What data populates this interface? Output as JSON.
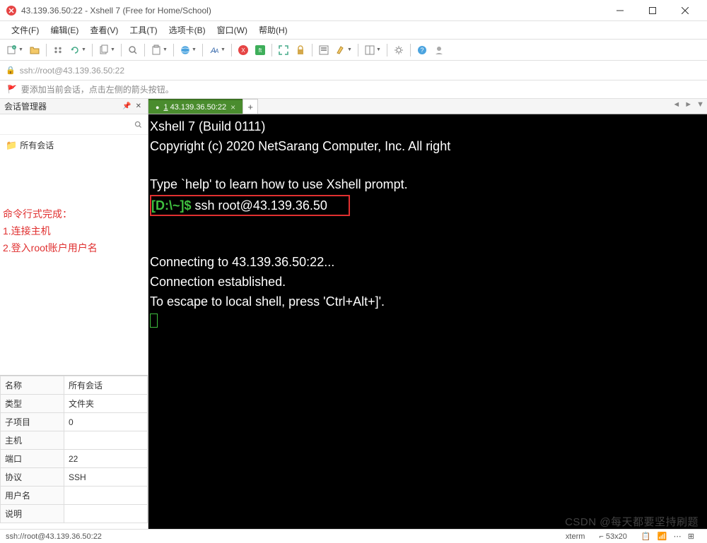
{
  "window": {
    "title": "43.139.36.50:22 - Xshell 7 (Free for Home/School)"
  },
  "menu": {
    "file": "文件(F)",
    "edit": "编辑(E)",
    "view": "查看(V)",
    "tools": "工具(T)",
    "tab": "选项卡(B)",
    "window": "窗口(W)",
    "help": "帮助(H)"
  },
  "addressbar": {
    "url": "ssh://root@43.139.36.50:22"
  },
  "infobar": {
    "text": "要添加当前会话，点击左侧的箭头按钮。"
  },
  "sidebar": {
    "title": "会话管理器",
    "tree_root": "所有会话",
    "annotations": {
      "line1": "命令行式完成：",
      "line2": "1.连接主机",
      "line3": "2.登入root账户用户名"
    },
    "props": [
      {
        "k": "名称",
        "v": "所有会话"
      },
      {
        "k": "类型",
        "v": "文件夹"
      },
      {
        "k": "子项目",
        "v": "0"
      },
      {
        "k": "主机",
        "v": ""
      },
      {
        "k": "端口",
        "v": "22"
      },
      {
        "k": "协议",
        "v": "SSH"
      },
      {
        "k": "用户名",
        "v": ""
      },
      {
        "k": "说明",
        "v": ""
      }
    ]
  },
  "tabs": {
    "active_prefix": "1",
    "active_label": " 43.139.36.50:22"
  },
  "terminal": {
    "line1": "Xshell 7 (Build 0111)",
    "line2": "Copyright (c) 2020 NetSarang Computer, Inc. All right",
    "line4": "Type `help' to learn how to use Xshell prompt.",
    "prompt": "[D:\\~]$",
    "cmd": " ssh root@43.139.36.50",
    "line7": "Connecting to 43.139.36.50:22...",
    "line8": "Connection established.",
    "line9": "To escape to local shell, press 'Ctrl+Alt+]'."
  },
  "statusbar": {
    "left": "ssh://root@43.139.36.50:22",
    "term_type": "xterm",
    "size": "⌐ 53x20"
  },
  "watermark": "CSDN @每天都要坚持刷题"
}
